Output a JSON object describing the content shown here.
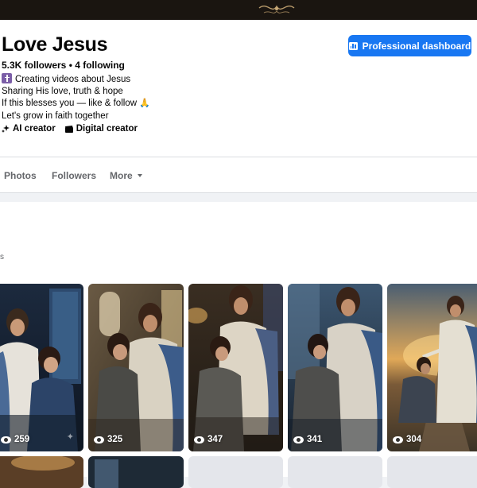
{
  "profile": {
    "name": "Love Jesus",
    "followers_line": "5.3K followers • 4 following",
    "bio": [
      "Creating videos about Jesus",
      "Sharing His love, truth & hope",
      "If this blesses you — like & follow",
      "Let's grow in faith together"
    ],
    "tags": [
      "AI creator",
      "Digital creator"
    ],
    "professional_dashboard_label": "Professional dashboard"
  },
  "tabs": [
    {
      "label": "Photos"
    },
    {
      "label": "Followers"
    },
    {
      "label": "More"
    }
  ],
  "section_label_fragment": "s",
  "reels": [
    {
      "views": "259"
    },
    {
      "views": "325"
    },
    {
      "views": "347"
    },
    {
      "views": "341"
    },
    {
      "views": "304"
    }
  ],
  "colors": {
    "accent": "#1877f2",
    "page_bg": "#f0f2f5",
    "secondary_text": "#65676b"
  },
  "icons": {
    "cross": "latin-cross-icon",
    "hands": "folded-hands-emoji",
    "ai_tag": "sparkle-icon",
    "digital_tag": "clapper-icon",
    "dashboard": "bar-chart-icon",
    "views": "eye-icon",
    "more": "caret-down-icon"
  }
}
